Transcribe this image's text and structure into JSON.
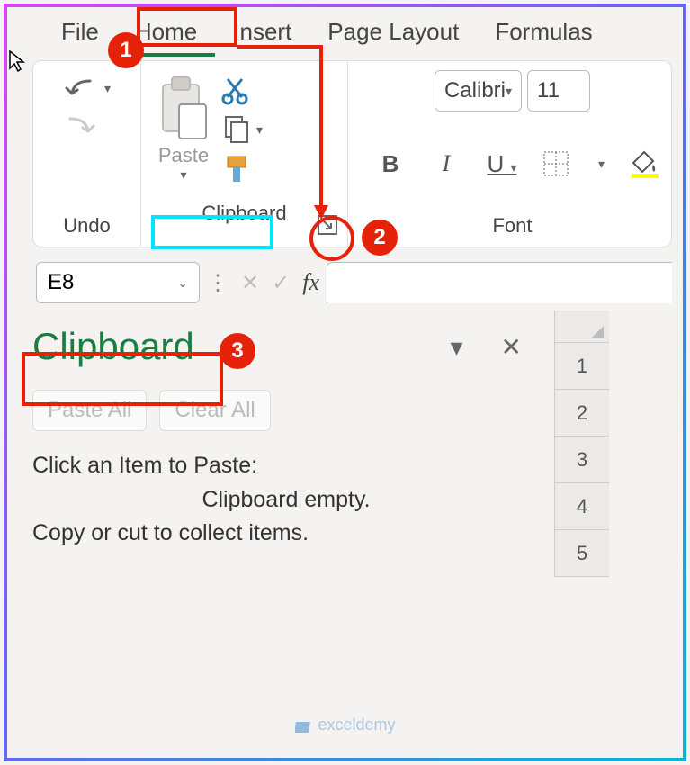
{
  "tabs": {
    "file": "File",
    "home": "Home",
    "insert": "Insert",
    "page_layout": "Page Layout",
    "formulas": "Formulas"
  },
  "ribbon": {
    "undo_label": "Undo",
    "clipboard_label": "Clipboard",
    "paste_label": "Paste",
    "font_label": "Font",
    "font_name": "Calibri",
    "font_size": "11"
  },
  "namebox": {
    "value": "E8",
    "fx": "fx"
  },
  "pane": {
    "title": "Clipboard",
    "paste_all": "Paste All",
    "clear_all": "Clear All",
    "hint": "Click an Item to Paste:",
    "empty1": "Clipboard empty.",
    "empty2": "Copy or cut to collect items."
  },
  "rows": [
    "1",
    "2",
    "3",
    "4",
    "5"
  ],
  "badges": {
    "b1": "1",
    "b2": "2",
    "b3": "3"
  },
  "watermark": "exceldemy"
}
